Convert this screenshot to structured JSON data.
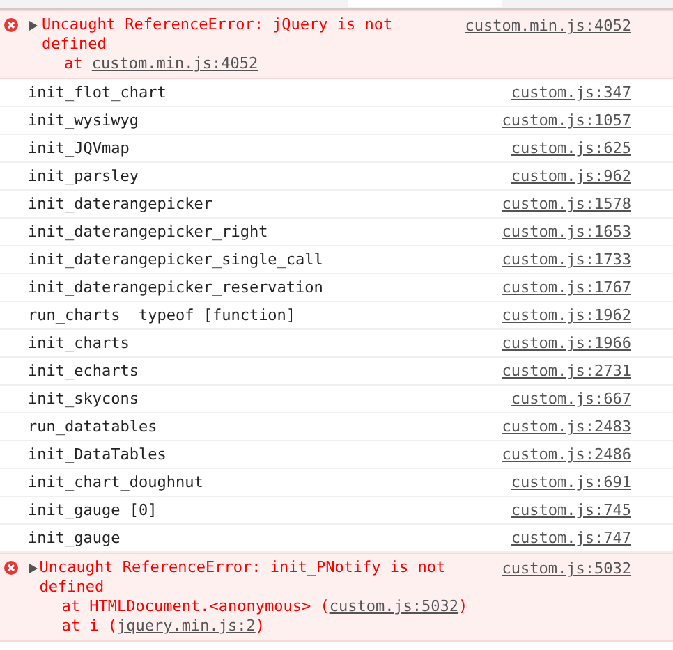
{
  "entries": [
    {
      "kind": "error",
      "message": "Uncaught ReferenceError: jQuery is not defined",
      "source": "custom.min.js:4052",
      "expanded": false,
      "stack": [
        {
          "before": "at ",
          "link": "custom.min.js:4052"
        }
      ]
    },
    {
      "kind": "log",
      "message": "init_flot_chart",
      "source": "custom.js:347"
    },
    {
      "kind": "log",
      "message": "init_wysiwyg",
      "source": "custom.js:1057"
    },
    {
      "kind": "log",
      "message": "init_JQVmap",
      "source": "custom.js:625"
    },
    {
      "kind": "log",
      "message": "init_parsley",
      "source": "custom.js:962"
    },
    {
      "kind": "log",
      "message": "init_daterangepicker",
      "source": "custom.js:1578"
    },
    {
      "kind": "log",
      "message": "init_daterangepicker_right",
      "source": "custom.js:1653"
    },
    {
      "kind": "log",
      "message": "init_daterangepicker_single_call",
      "source": "custom.js:1733"
    },
    {
      "kind": "log",
      "message": "init_daterangepicker_reservation",
      "source": "custom.js:1767"
    },
    {
      "kind": "log",
      "message": "run_charts  typeof [function]",
      "source": "custom.js:1962"
    },
    {
      "kind": "log",
      "message": "init_charts",
      "source": "custom.js:1966"
    },
    {
      "kind": "log",
      "message": "init_echarts",
      "source": "custom.js:2731"
    },
    {
      "kind": "log",
      "message": "init_skycons",
      "source": "custom.js:667"
    },
    {
      "kind": "log",
      "message": "run_datatables",
      "source": "custom.js:2483"
    },
    {
      "kind": "log",
      "message": "init_DataTables",
      "source": "custom.js:2486"
    },
    {
      "kind": "log",
      "message": "init_chart_doughnut",
      "source": "custom.js:691"
    },
    {
      "kind": "log",
      "message": "init_gauge [0]",
      "source": "custom.js:745"
    },
    {
      "kind": "log",
      "message": "init_gauge",
      "source": "custom.js:747"
    },
    {
      "kind": "error",
      "message": "Uncaught ReferenceError: init_PNotify is not defined",
      "source": "custom.js:5032",
      "expanded": false,
      "stack": [
        {
          "before": "at HTMLDocument.<anonymous> (",
          "link": "custom.js:5032",
          "after": ")"
        },
        {
          "before": "at i (",
          "link": "jquery.min.js:2",
          "after": ")"
        }
      ]
    }
  ]
}
